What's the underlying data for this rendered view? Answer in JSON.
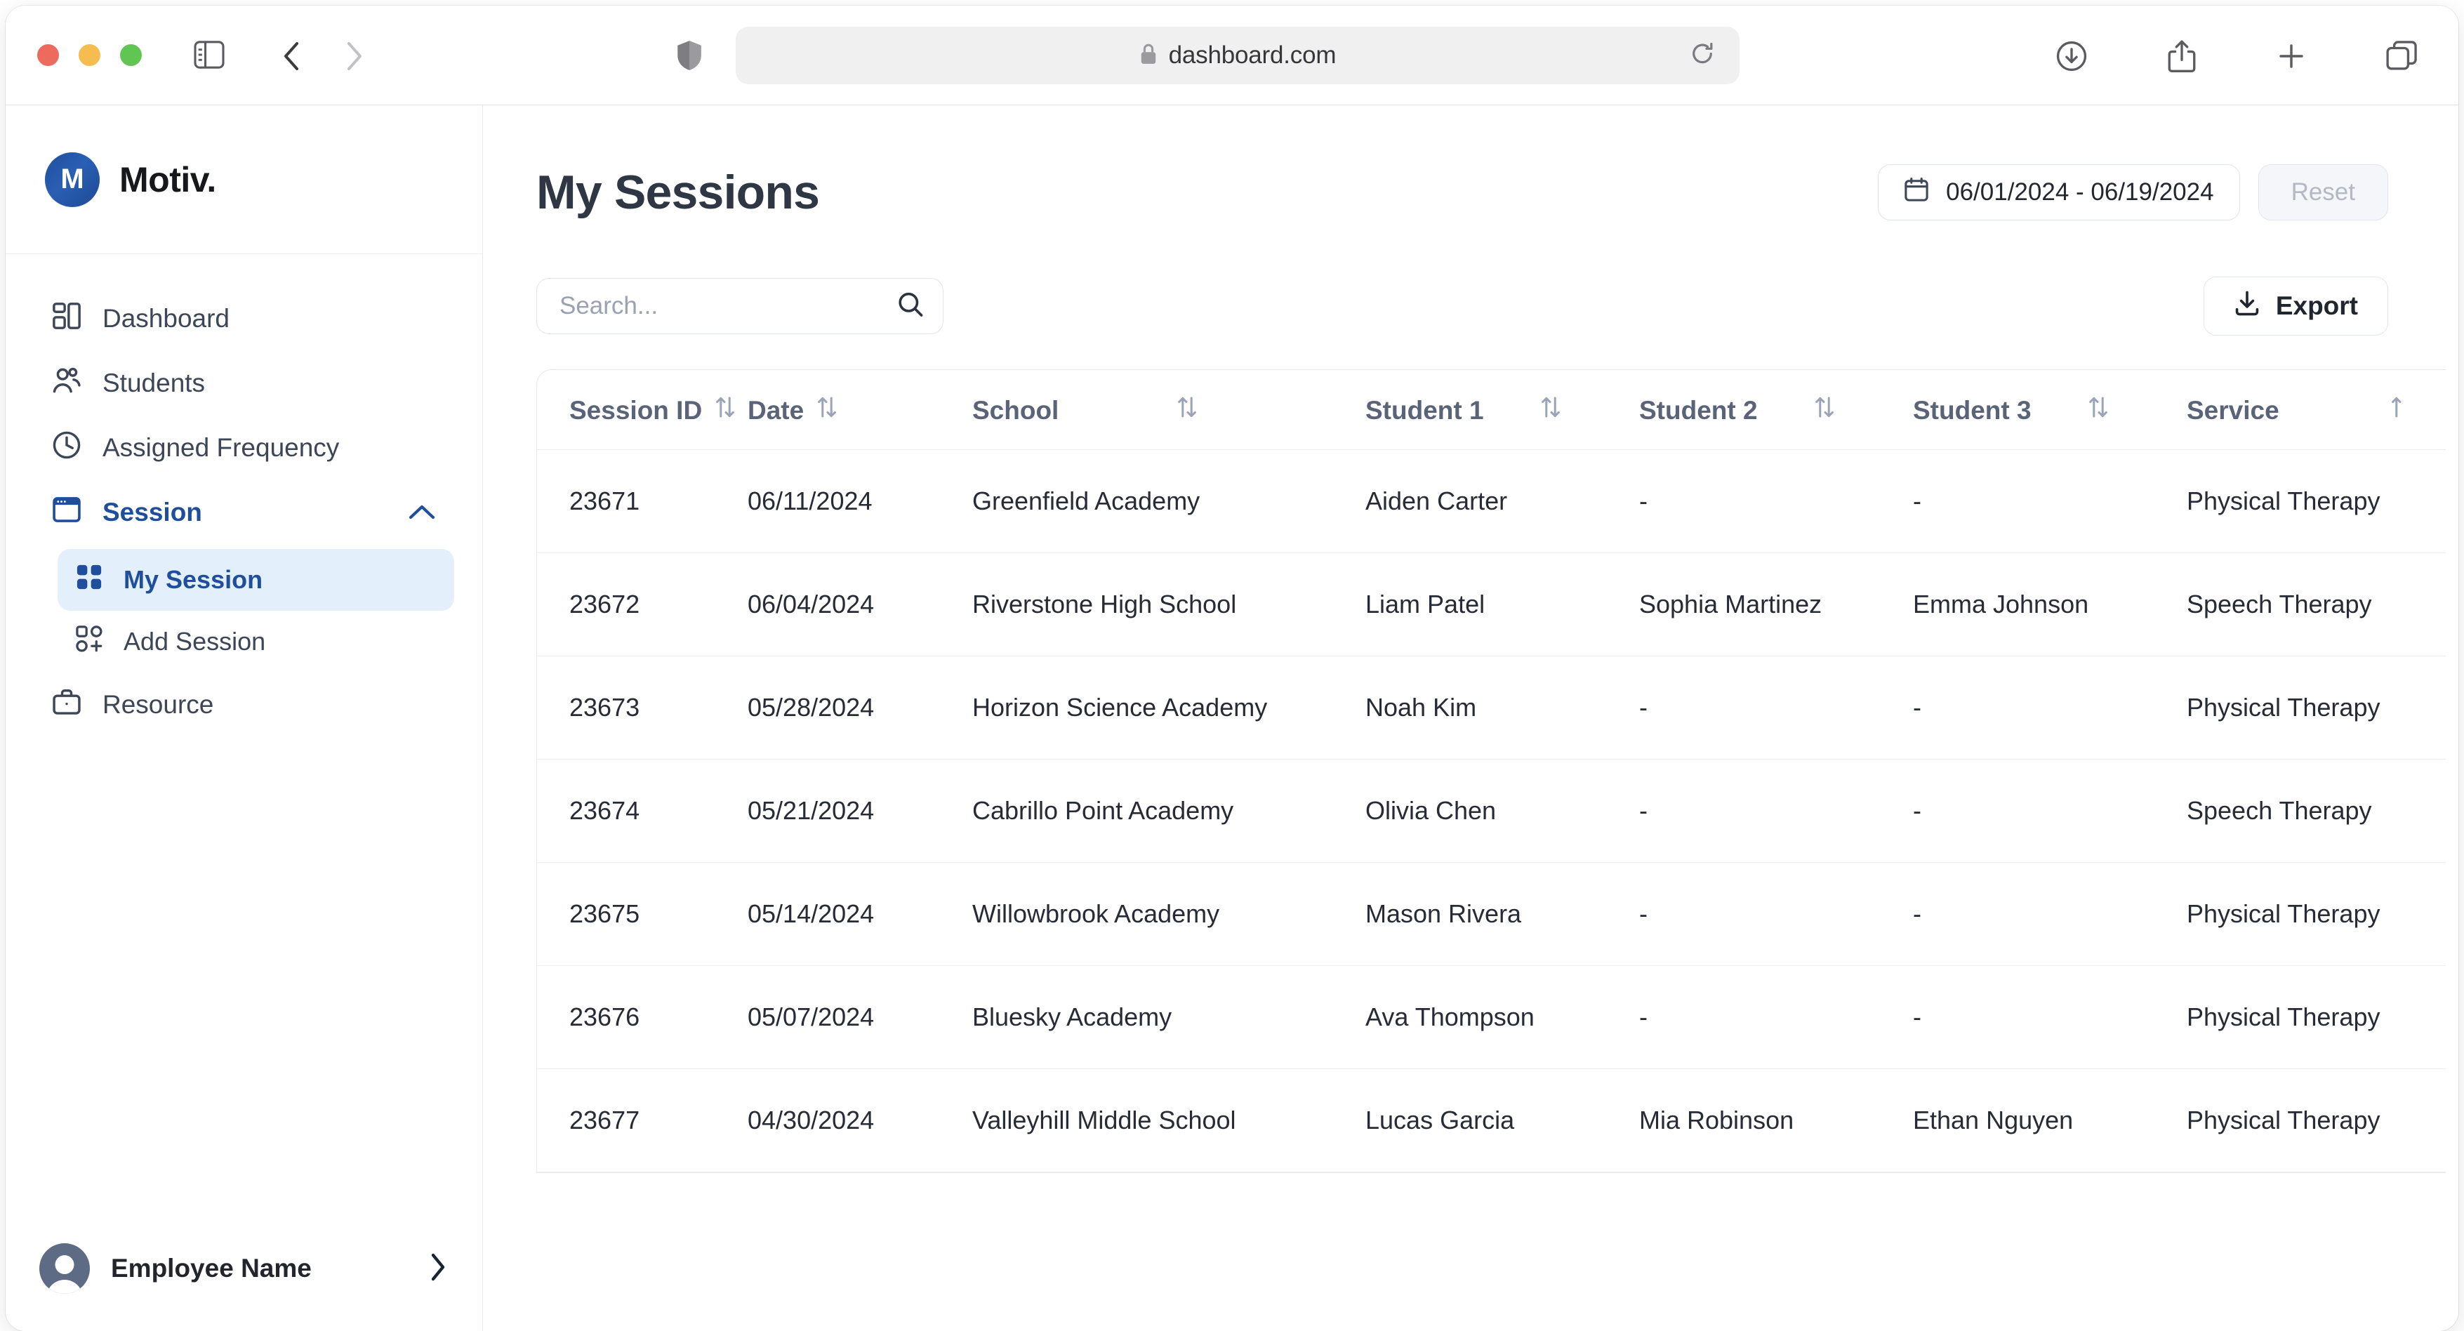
{
  "browser": {
    "url": "dashboard.com",
    "lock_icon": "lock-icon",
    "shield_icon": "shield-icon",
    "sidebar_toggle_icon": "sidebar-toggle-icon",
    "back_icon": "chevron-left-icon",
    "forward_icon": "chevron-right-icon",
    "reload_icon": "reload-icon",
    "downloads_icon": "download-circle-icon",
    "share_icon": "share-icon",
    "new_tab_icon": "plus-icon",
    "tabs_icon": "tab-overview-icon"
  },
  "sidebar": {
    "brand": {
      "mark": "M",
      "name": "Motiv."
    },
    "items": [
      {
        "label": "Dashboard",
        "icon": "layout-dashboard-icon"
      },
      {
        "label": "Students",
        "icon": "users-icon"
      },
      {
        "label": "Assigned Frequency",
        "icon": "clock-icon"
      },
      {
        "label": "Session",
        "icon": "window-icon",
        "expanded": true,
        "chevron": "chevron-up-icon"
      },
      {
        "label": "Resource",
        "icon": "briefcase-icon"
      }
    ],
    "subitems": [
      {
        "label": "My Session",
        "icon": "grid-icon",
        "active": true
      },
      {
        "label": "Add Session",
        "icon": "grid-plus-icon",
        "active": false
      }
    ],
    "profile": {
      "name": "Employee Name",
      "avatar": "avatar-icon",
      "chevron": "chevron-right-icon"
    }
  },
  "header": {
    "title": "My Sessions",
    "date_range": "06/01/2024 - 06/19/2024",
    "calendar_icon": "calendar-icon",
    "reset_label": "Reset"
  },
  "toolbar": {
    "search_placeholder": "Search...",
    "search_value": "",
    "search_icon": "search-icon",
    "export_label": "Export",
    "export_icon": "download-icon"
  },
  "table": {
    "sort_icon": "sort-arrows-icon",
    "columns": [
      "Session ID",
      "Date",
      "School",
      "Student 1",
      "Student 2",
      "Student 3",
      "Service"
    ],
    "rows": [
      {
        "session_id": "23671",
        "date": "06/11/2024",
        "school": "Greenfield Academy",
        "student1": "Aiden Carter",
        "student2": "-",
        "student3": "-",
        "service": "Physical Therapy"
      },
      {
        "session_id": "23672",
        "date": "06/04/2024",
        "school": "Riverstone High School",
        "student1": "Liam Patel",
        "student2": "Sophia Martinez",
        "student3": "Emma Johnson",
        "service": "Speech Therapy"
      },
      {
        "session_id": "23673",
        "date": "05/28/2024",
        "school": "Horizon Science Academy",
        "student1": "Noah Kim",
        "student2": "-",
        "student3": "-",
        "service": "Physical Therapy"
      },
      {
        "session_id": "23674",
        "date": "05/21/2024",
        "school": "Cabrillo Point Academy",
        "student1": "Olivia Chen",
        "student2": "-",
        "student3": "-",
        "service": "Speech Therapy"
      },
      {
        "session_id": "23675",
        "date": "05/14/2024",
        "school": "Willowbrook Academy",
        "student1": "Mason Rivera",
        "student2": "-",
        "student3": "-",
        "service": "Physical Therapy"
      },
      {
        "session_id": "23676",
        "date": "05/07/2024",
        "school": "Bluesky Academy",
        "student1": "Ava Thompson",
        "student2": "-",
        "student3": "-",
        "service": "Physical Therapy"
      },
      {
        "session_id": "23677",
        "date": "04/30/2024",
        "school": "Valleyhill Middle School",
        "student1": "Lucas Garcia",
        "student2": "Mia Robinson",
        "student3": "Ethan Nguyen",
        "service": "Physical Therapy"
      }
    ]
  },
  "colors": {
    "accent": "#1f4f9c",
    "accent_soft": "#e3f0fc",
    "text": "#262b35",
    "muted": "#5a6478"
  }
}
